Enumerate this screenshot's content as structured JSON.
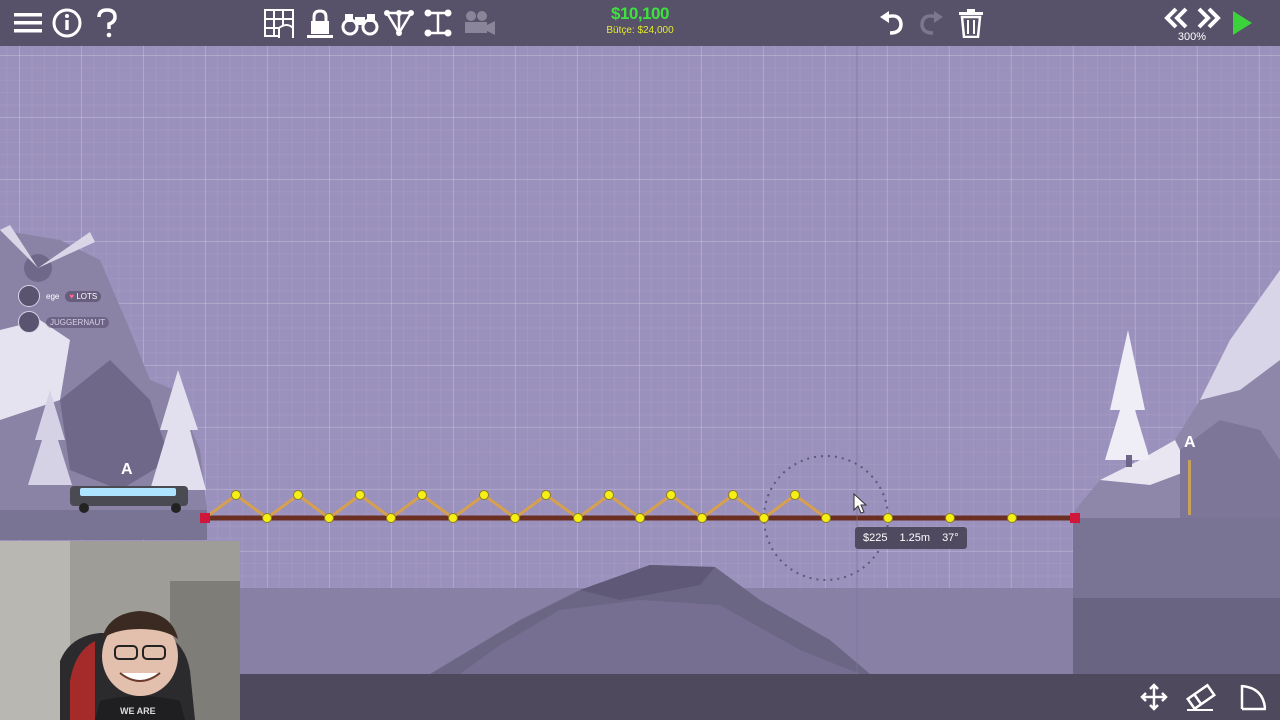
{
  "budget": {
    "money": "$10,100",
    "label": "Bütçe: $24,000"
  },
  "zoom": "300%",
  "tooltip": {
    "cost": "$225",
    "length": "1.25m",
    "angle": "37°"
  },
  "checkpoints": {
    "left": "A",
    "right": "A"
  },
  "chat": {
    "user1": {
      "name": "ege",
      "badge": "LOTS"
    },
    "user2": {
      "name": "JUGGERNAUT"
    }
  },
  "webcam_shirt": "WE ARE",
  "icons": {
    "top_left": [
      "menu-icon",
      "info-icon",
      "help-icon"
    ],
    "top_tools": [
      "grid-icon",
      "lock-icon",
      "binoculars-icon",
      "truss-icon",
      "joint-icon",
      "camera-icon"
    ],
    "top_right": [
      "undo-icon",
      "redo-icon",
      "trash-icon",
      "rewind-icon",
      "fast-forward-icon",
      "play-icon"
    ],
    "bottom_right": [
      "move-icon",
      "eraser-icon",
      "curve-icon"
    ]
  },
  "colors": {
    "money": "#3de33d",
    "budget_label": "#e6ea2b",
    "joint": "#f5ef15",
    "anchor": "#d0173b",
    "wood": "#d6a04f",
    "road": "#6b2f22",
    "play": "#3bd23b"
  }
}
